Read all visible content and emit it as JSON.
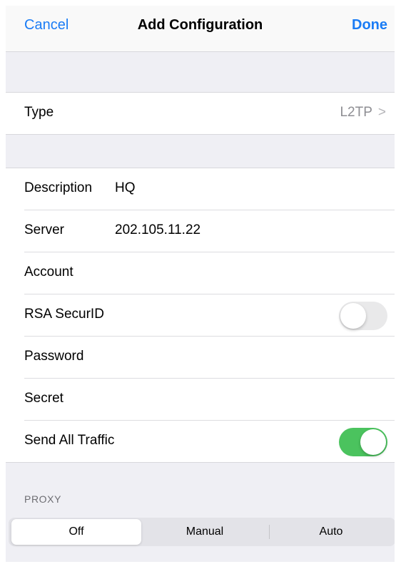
{
  "nav": {
    "cancel_label": "Cancel",
    "title": "Add Configuration",
    "done_label": "Done"
  },
  "type_row": {
    "label": "Type",
    "value": "L2TP",
    "chevron": ">"
  },
  "fields": {
    "description": {
      "label": "Description",
      "value": "HQ"
    },
    "server": {
      "label": "Server",
      "value": "202.105.11.22"
    },
    "account": {
      "label": "Account",
      "value": ""
    },
    "rsa": {
      "label": "RSA SecurID",
      "enabled": false
    },
    "password": {
      "label": "Password",
      "value": ""
    },
    "secret": {
      "label": "Secret",
      "value": ""
    },
    "send_all": {
      "label": "Send All Traffic",
      "enabled": true
    }
  },
  "proxy": {
    "header": "PROXY",
    "options": [
      "Off",
      "Manual",
      "Auto"
    ],
    "selected": "Off"
  },
  "colors": {
    "accent": "#1a7cf5",
    "toggle_on": "#4bc35e",
    "toggle_off": "#e9e9ea",
    "grouped_background": "#efeff4",
    "secondary_text": "#8e8e93"
  }
}
